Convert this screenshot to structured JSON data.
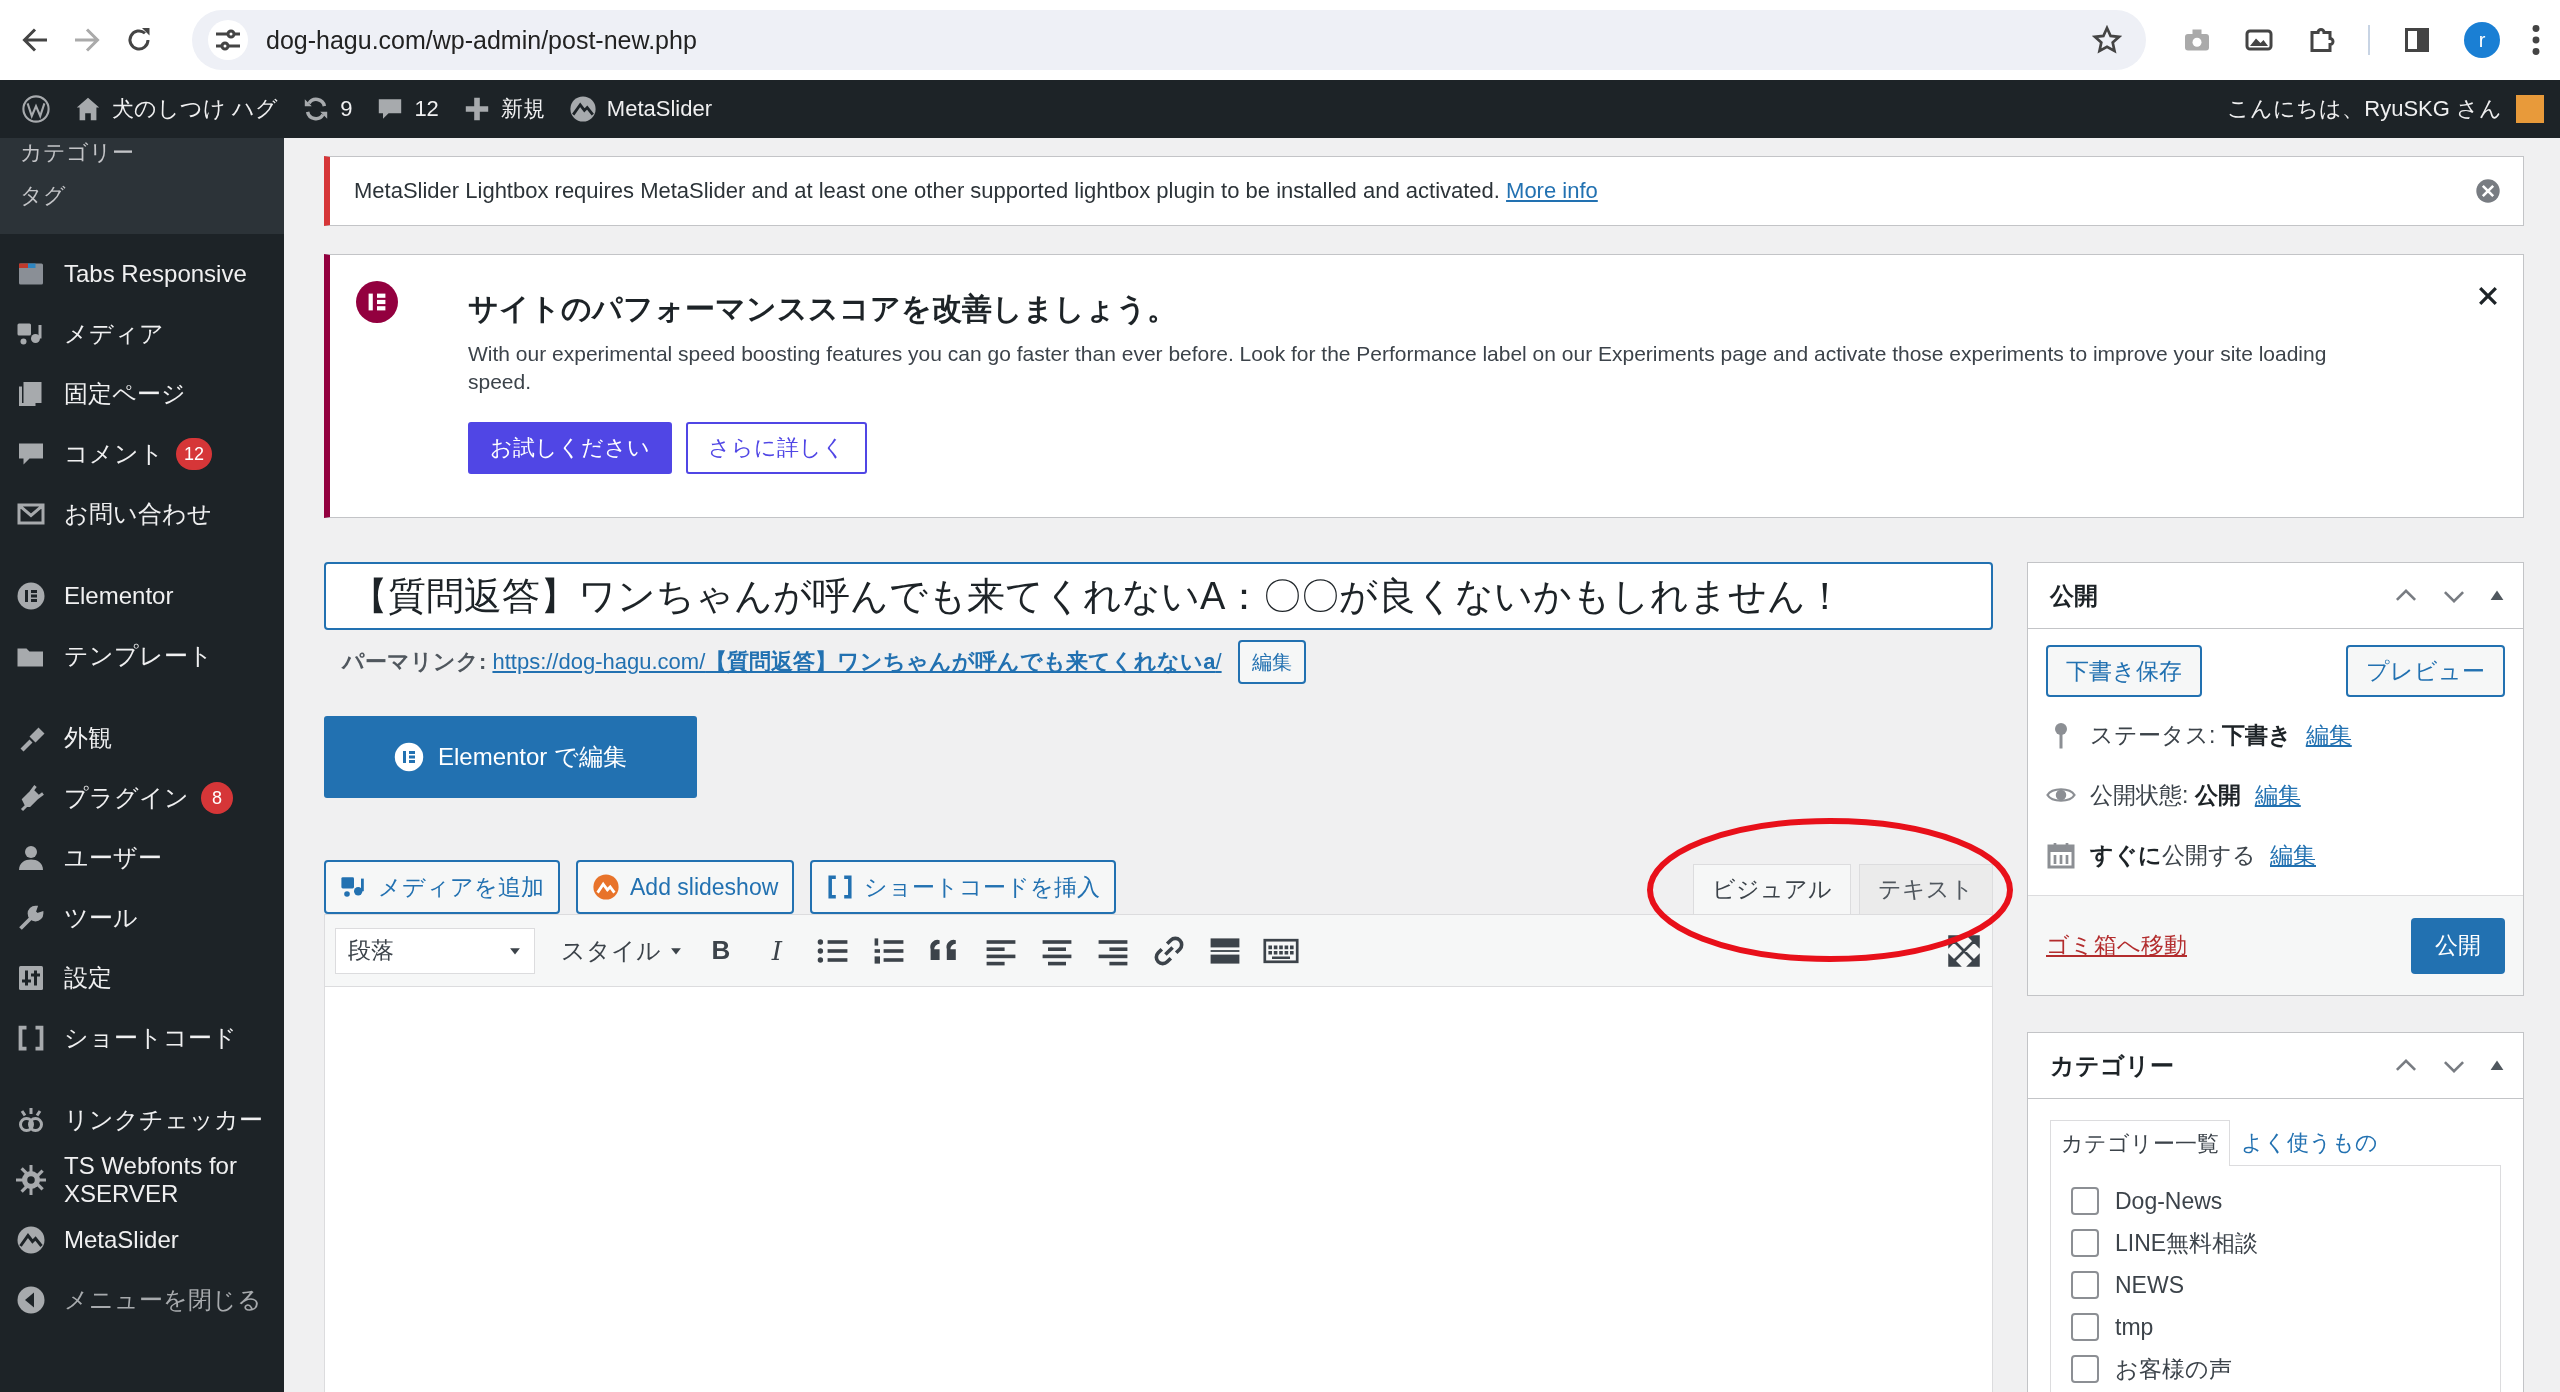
{
  "browser": {
    "url": "dog-hagu.com/wp-admin/post-new.php",
    "profile": "r"
  },
  "admin_bar": {
    "items": [
      {
        "kind": "logo"
      },
      {
        "kind": "site",
        "label": "犬のしつけ ハグ"
      },
      {
        "kind": "updates",
        "label": "9"
      },
      {
        "kind": "comments",
        "label": "12"
      },
      {
        "kind": "new",
        "label": "新規"
      },
      {
        "kind": "metaslider",
        "label": "MetaSlider"
      }
    ],
    "greeting": "こんにちは、RyuSKG さん"
  },
  "sidebar": {
    "submenu": [
      "カテゴリー",
      "タグ"
    ],
    "groups": [
      [
        {
          "kind": "tabs",
          "label": "Tabs Responsive"
        },
        {
          "kind": "media",
          "label": "メディア"
        },
        {
          "kind": "pages",
          "label": "固定ページ"
        },
        {
          "kind": "comments",
          "label": "コメント",
          "badge": "12"
        },
        {
          "kind": "contact",
          "label": "お問い合わせ"
        }
      ],
      [
        {
          "kind": "elementor",
          "label": "Elementor"
        },
        {
          "kind": "templates",
          "label": "テンプレート"
        }
      ],
      [
        {
          "kind": "appearance",
          "label": "外観"
        },
        {
          "kind": "plugins",
          "label": "プラグイン",
          "badge": "8"
        },
        {
          "kind": "users",
          "label": "ユーザー"
        },
        {
          "kind": "tools",
          "label": "ツール"
        },
        {
          "kind": "settings",
          "label": "設定"
        },
        {
          "kind": "shortcode",
          "label": "ショートコード"
        }
      ],
      [
        {
          "kind": "linkchecker",
          "label": "リンクチェッカー"
        },
        {
          "kind": "gear",
          "label": "TS Webfonts for XSERVER"
        },
        {
          "kind": "metaslider",
          "label": "MetaSlider"
        },
        {
          "kind": "collapse",
          "label": "メニューを閉じる"
        }
      ]
    ]
  },
  "notices": [
    {
      "kind": "error",
      "text": "MetaSlider Lightbox requires MetaSlider and at least one other supported lightbox plugin to be installed and activated.",
      "link": "More info"
    },
    {
      "kind": "elementor",
      "title": "サイトのパフォーマンススコアを改善しましょう。",
      "text": "With our experimental speed boosting features you can go faster than ever before. Look for the Performance label on our Experiments page and activate those experiments to improve your site loading speed.",
      "buttons": [
        {
          "kind": "primary",
          "label": "お試しください"
        },
        {
          "kind": "outline",
          "label": "さらに詳しく"
        }
      ]
    }
  ],
  "editor": {
    "title": "【質問返答】ワンちゃんが呼んでも来てくれないA：〇〇が良くないかもしれません！",
    "permalink": {
      "label": "パーマリンク:",
      "url_base": "https://dog-hagu.com/",
      "slug": "【質問返答】ワンちゃんが呼んでも来てくれないa",
      "suffix": "/",
      "edit": "編集"
    },
    "elementor_button": "Elementor で編集",
    "media_buttons": [
      {
        "kind": "media",
        "label": "メディアを追加"
      },
      {
        "kind": "slideshow",
        "label": "Add slideshow"
      },
      {
        "kind": "shortcode",
        "label": "ショートコードを挿入"
      }
    ],
    "tabs": [
      {
        "label": "ビジュアル",
        "selected": true
      },
      {
        "label": "テキスト",
        "selected": false
      }
    ],
    "format": "段落",
    "style": "スタイル",
    "bold": "B",
    "italic": "I"
  },
  "publish": {
    "title": "公開",
    "save_draft": "下書き保存",
    "preview": "プレビュー",
    "rows": [
      {
        "kind": "status",
        "text": "ステータス: **下書き**",
        "link": "編集"
      },
      {
        "kind": "visibility",
        "text": "公開状態: **公開**",
        "link": "編集"
      },
      {
        "kind": "schedule",
        "text": "**すぐに**公開する",
        "link": "編集"
      }
    ],
    "trash": "ゴミ箱へ移動",
    "publish_button": "公開"
  },
  "categories": {
    "title": "カテゴリー",
    "tabs": [
      {
        "label": "カテゴリー一覧",
        "selected": true
      },
      {
        "label": "よく使うもの",
        "selected": false
      }
    ],
    "items": [
      {
        "label": "Dog-News",
        "checked": false
      },
      {
        "label": "LINE無料相談",
        "checked": false
      },
      {
        "label": "NEWS",
        "checked": false
      },
      {
        "label": "tmp",
        "checked": false
      },
      {
        "label": "お客様の声",
        "checked": false
      }
    ]
  }
}
